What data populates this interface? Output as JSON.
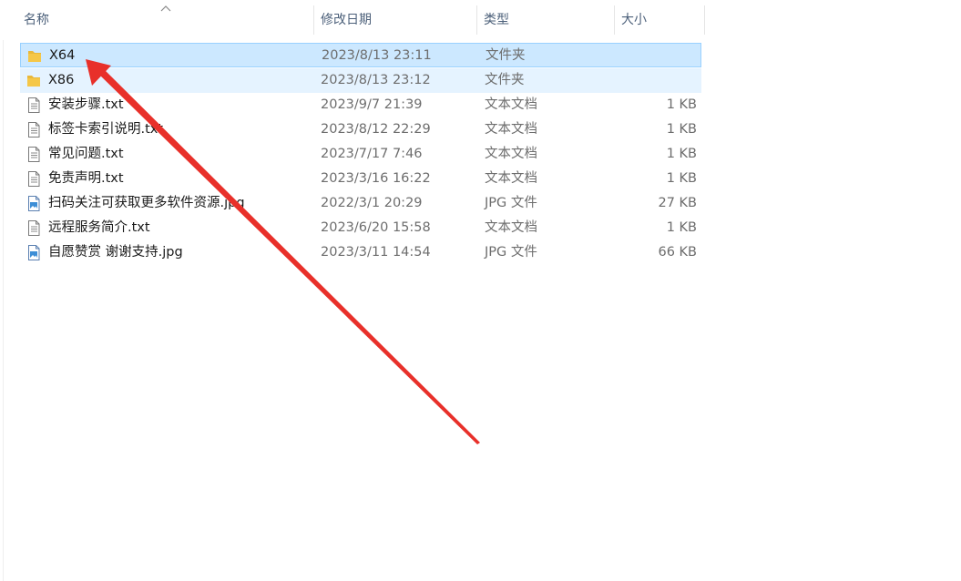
{
  "columns": {
    "name": "名称",
    "modified": "修改日期",
    "type": "类型",
    "size": "大小"
  },
  "files": [
    {
      "name": "X64",
      "modified": "2023/8/13 23:11",
      "type": "文件夹",
      "size": "",
      "icon": "folder-icon",
      "state": "selected"
    },
    {
      "name": "X86",
      "modified": "2023/8/13 23:12",
      "type": "文件夹",
      "size": "",
      "icon": "folder-icon",
      "state": "hover"
    },
    {
      "name": "安装步骤.txt",
      "modified": "2023/9/7 21:39",
      "type": "文本文档",
      "size": "1 KB",
      "icon": "text-file-icon",
      "state": ""
    },
    {
      "name": "标签卡索引说明.txt",
      "modified": "2023/8/12 22:29",
      "type": "文本文档",
      "size": "1 KB",
      "icon": "text-file-icon",
      "state": ""
    },
    {
      "name": "常见问题.txt",
      "modified": "2023/7/17 7:46",
      "type": "文本文档",
      "size": "1 KB",
      "icon": "text-file-icon",
      "state": ""
    },
    {
      "name": "免责声明.txt",
      "modified": "2023/3/16 16:22",
      "type": "文本文档",
      "size": "1 KB",
      "icon": "text-file-icon",
      "state": ""
    },
    {
      "name": "扫码关注可获取更多软件资源.jpg",
      "modified": "2022/3/1 20:29",
      "type": "JPG 文件",
      "size": "27 KB",
      "icon": "image-file-icon",
      "state": ""
    },
    {
      "name": "远程服务简介.txt",
      "modified": "2023/6/20 15:58",
      "type": "文本文档",
      "size": "1 KB",
      "icon": "text-file-icon",
      "state": ""
    },
    {
      "name": "自愿赞赏 谢谢支持.jpg",
      "modified": "2023/3/11 14:54",
      "type": "JPG 文件",
      "size": "66 KB",
      "icon": "image-file-icon",
      "state": ""
    }
  ],
  "colors": {
    "selection": "#cce8ff",
    "hover": "#e5f3ff",
    "annotation_arrow": "#e8302a",
    "folder": "#f5c748"
  }
}
